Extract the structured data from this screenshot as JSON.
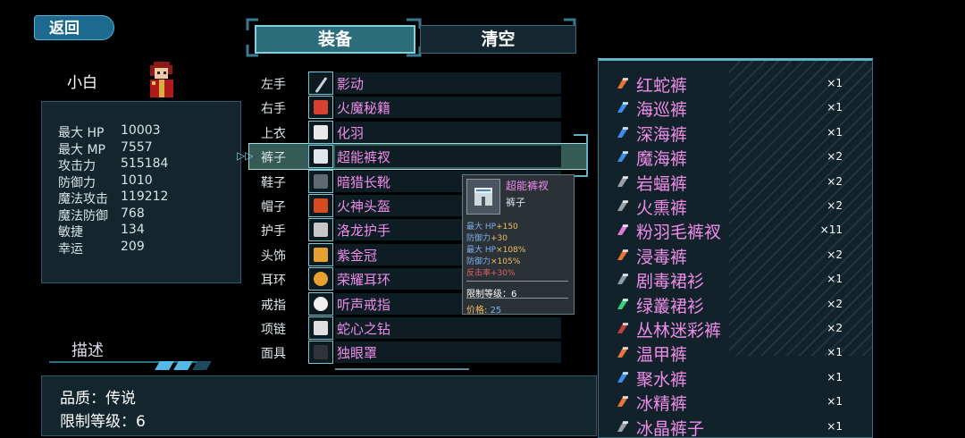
{
  "back_label": "返回",
  "character": {
    "name": "小白"
  },
  "stats": [
    {
      "label": "最大 HP",
      "value": "10003"
    },
    {
      "label": "最大 MP",
      "value": "7557"
    },
    {
      "label": "攻击力",
      "value": "515184"
    },
    {
      "label": "防御力",
      "value": "1010"
    },
    {
      "label": "魔法攻击",
      "value": "119212"
    },
    {
      "label": "魔法防御",
      "value": "768"
    },
    {
      "label": "敏捷",
      "value": "134"
    },
    {
      "label": "幸运",
      "value": "209"
    }
  ],
  "description": {
    "title": "描述",
    "lines": [
      "品质：传说",
      "限制等级：6"
    ]
  },
  "tabs": {
    "equip": "装备",
    "clear": "清空"
  },
  "slots": [
    {
      "label": "左手",
      "item": "影动",
      "icon": "sword-icon"
    },
    {
      "label": "右手",
      "item": "火魔秘籍",
      "icon": "book-icon"
    },
    {
      "label": "上衣",
      "item": "化羽",
      "icon": "armor-icon"
    },
    {
      "label": "裤子",
      "item": "超能裤衩",
      "icon": "pants-icon"
    },
    {
      "label": "鞋子",
      "item": "暗猎长靴",
      "icon": "boots-icon"
    },
    {
      "label": "帽子",
      "item": "火神头盔",
      "icon": "helmet-icon"
    },
    {
      "label": "护手",
      "item": "洛龙护手",
      "icon": "gauntlet-icon"
    },
    {
      "label": "头饰",
      "item": "紫金冠",
      "icon": "crown-icon"
    },
    {
      "label": "耳环",
      "item": "荣耀耳环",
      "icon": "earring-icon"
    },
    {
      "label": "戒指",
      "item": "听声戒指",
      "icon": "ring-icon"
    },
    {
      "label": "项链",
      "item": "蛇心之钻",
      "icon": "necklace-icon"
    },
    {
      "label": "面具",
      "item": "独眼罩",
      "icon": "eyepatch-icon"
    }
  ],
  "selected_slot": 3,
  "tooltip": {
    "name": "超能裤衩",
    "type": "裤子",
    "stats": [
      {
        "label": "最大 HP",
        "bonus": "+150",
        "red": false
      },
      {
        "label": "防御力",
        "bonus": "+30",
        "red": false
      },
      {
        "label": "最大 HP",
        "bonus": "×108%",
        "red": false
      },
      {
        "label": "防御力",
        "bonus": "×105%",
        "red": false
      },
      {
        "label": "反击率",
        "bonus": "+30%",
        "red": true
      }
    ],
    "level_text": "限制等级：6",
    "price_label": "价格:",
    "price_value": "25"
  },
  "inventory": [
    {
      "name": "红蛇裤",
      "qty": "×1",
      "icon": "orange-pants-icon",
      "color": "#e8743a"
    },
    {
      "name": "海巡裤",
      "qty": "×1",
      "icon": "blue-pants-icon",
      "color": "#3b8de8"
    },
    {
      "name": "深海裤",
      "qty": "×1",
      "icon": "blue-pants-icon",
      "color": "#3b8de8"
    },
    {
      "name": "魔海裤",
      "qty": "×2",
      "icon": "blue-pants-icon",
      "color": "#3b8de8"
    },
    {
      "name": "岩蝠裤",
      "qty": "×2",
      "icon": "gray-pants-icon",
      "color": "#9aa0a6"
    },
    {
      "name": "火熏裤",
      "qty": "×2",
      "icon": "gray-pants-icon",
      "color": "#9aa0a6"
    },
    {
      "name": "粉羽毛裤衩",
      "qty": "×11",
      "icon": "pink-shorts-icon",
      "color": "#e07ad8"
    },
    {
      "name": "浸毒裤",
      "qty": "×2",
      "icon": "orange-pants-icon",
      "color": "#e8743a"
    },
    {
      "name": "剧毒裙衫",
      "qty": "×1",
      "icon": "gray-skirt-icon",
      "color": "#8a9aa6"
    },
    {
      "name": "绿叢裙衫",
      "qty": "×2",
      "icon": "green-skirt-icon",
      "color": "#3ad07a"
    },
    {
      "name": "丛林迷彩裤",
      "qty": "×2",
      "icon": "camo-pants-icon",
      "color": "#c04040"
    },
    {
      "name": "温甲裤",
      "qty": "×1",
      "icon": "orange-pants-icon",
      "color": "#e8743a"
    },
    {
      "name": "聚水裤",
      "qty": "×1",
      "icon": "blue-pants-icon",
      "color": "#3b8de8"
    },
    {
      "name": "冰精裤",
      "qty": "×1",
      "icon": "orange-pants-icon",
      "color": "#e8743a"
    },
    {
      "name": "冰晶裤子",
      "qty": "×1",
      "icon": "gray-pants-icon",
      "color": "#9aa0a6"
    }
  ]
}
